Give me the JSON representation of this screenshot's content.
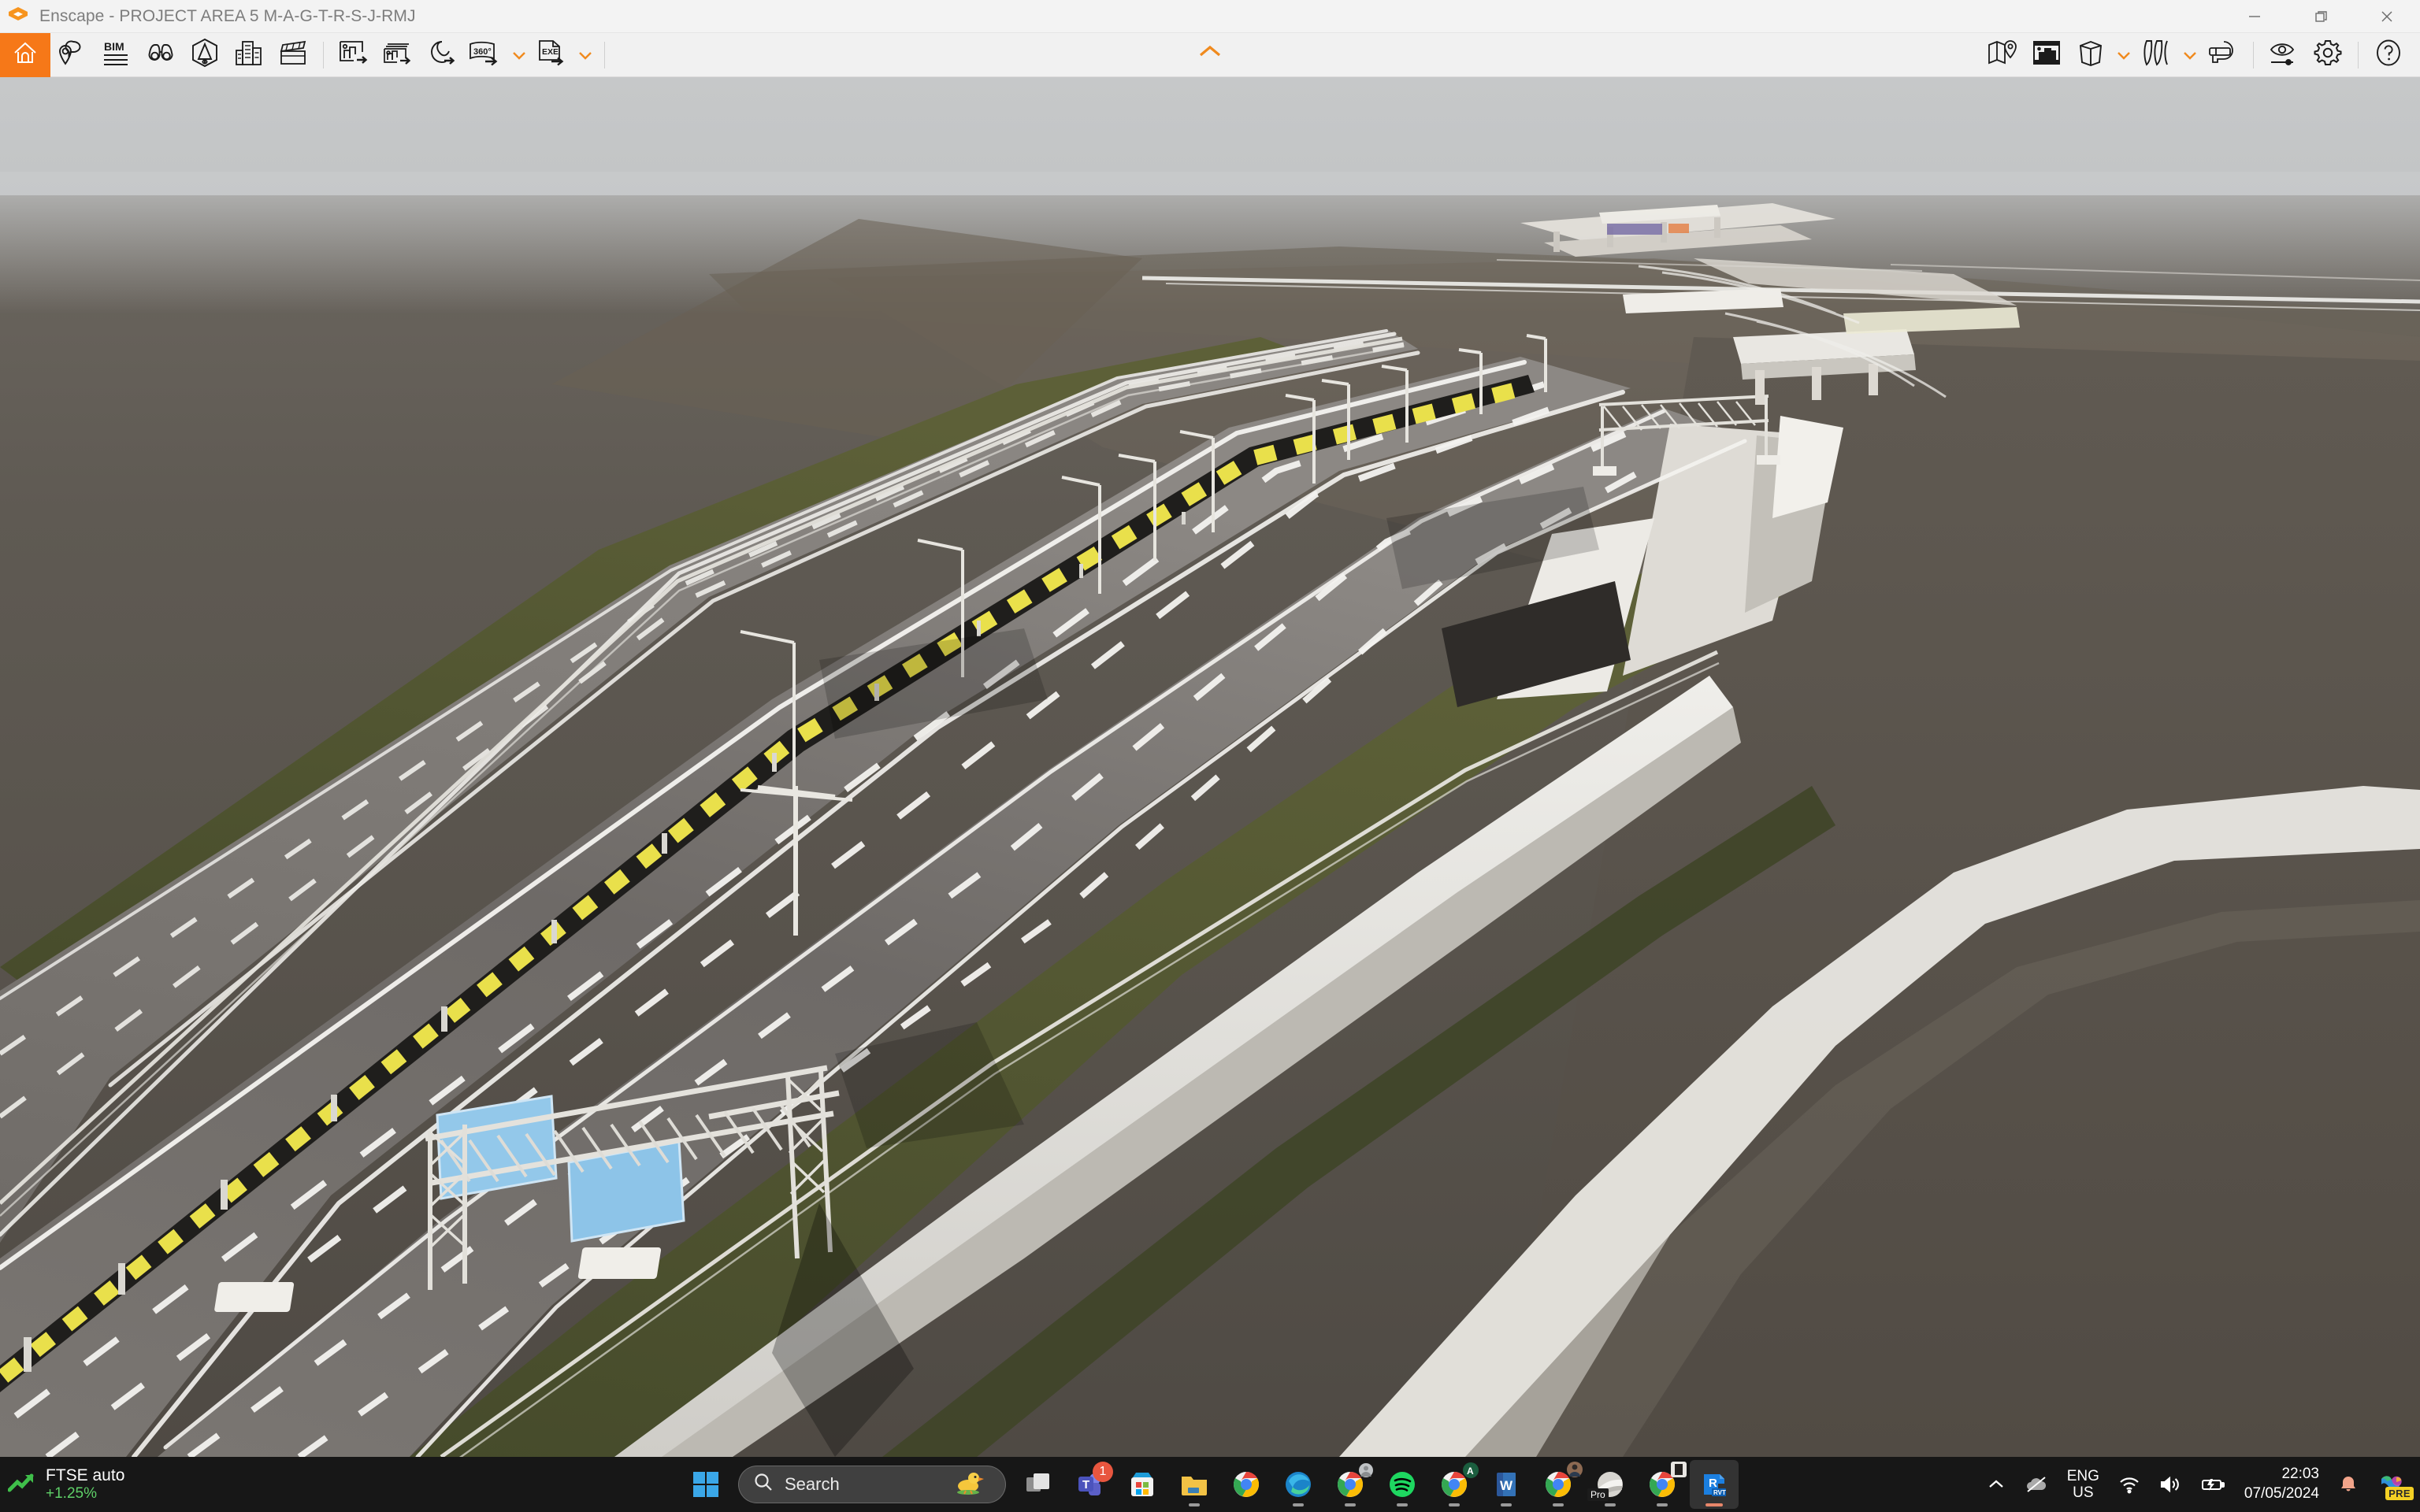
{
  "window": {
    "app_name": "Enscape",
    "title": "Enscape - PROJECT AREA 5 M-A-G-T-R-S-J-RMJ",
    "controls": {
      "minimize": "Minimize",
      "restore": "Restore",
      "close": "Close"
    },
    "accent_color": "#f67818",
    "titlebar_bg": "#f3f3f3",
    "toolbar_bg": "#f1f1f1"
  },
  "toolbar": {
    "left_items": [
      {
        "name": "home",
        "label": "Home",
        "icon": "home-icon"
      },
      {
        "name": "views",
        "label": "Views",
        "icon": "pin-chat-icon"
      },
      {
        "name": "bim",
        "label": "BIM Info",
        "icon": "bim-icon"
      },
      {
        "name": "visual_presets",
        "label": "Visual Settings Presets",
        "icon": "binoculars-icon"
      },
      {
        "name": "asset_library",
        "label": "Asset Library",
        "icon": "asset-box-icon"
      },
      {
        "name": "material_library",
        "label": "Material Library",
        "icon": "buildings-icon"
      },
      {
        "name": "video_editor",
        "label": "Video Editor",
        "icon": "clapperboard-icon"
      },
      {
        "name": "render_image",
        "label": "Render Image",
        "icon": "render-image-icon"
      },
      {
        "name": "batch_render",
        "label": "Batch Rendering",
        "icon": "batch-render-icon"
      },
      {
        "name": "panorama",
        "label": "Render Panorama",
        "icon": "panorama-icon"
      },
      {
        "name": "export_360",
        "label": "360",
        "icon": "export-360-icon",
        "has_dropdown": true
      },
      {
        "name": "export_exe",
        "label": "EXE",
        "icon": "export-exe-icon",
        "has_dropdown": true
      }
    ],
    "right_items": [
      {
        "name": "site_context",
        "label": "Site Context",
        "icon": "map-pin-icon"
      },
      {
        "name": "project_view",
        "label": "Project",
        "icon": "project-frame-icon"
      },
      {
        "name": "view_mode",
        "label": "View Mode",
        "icon": "cube-icon",
        "has_dropdown": true
      },
      {
        "name": "atmosphere",
        "label": "Atmosphere",
        "icon": "curtains-icon",
        "has_dropdown": true
      },
      {
        "name": "vr_mode",
        "label": "Virtual Reality",
        "icon": "vr-headset-icon"
      },
      {
        "name": "visual_settings",
        "label": "Visual Settings",
        "icon": "eye-slider-icon"
      },
      {
        "name": "settings",
        "label": "Settings",
        "icon": "gear-icon"
      },
      {
        "name": "help",
        "label": "Help",
        "icon": "question-icon"
      }
    ],
    "collapse_label": "Collapse toolbar",
    "caret_color": "#f08a1e"
  },
  "viewport": {
    "name": "enscape-3d-render-viewport",
    "description": "Real-time rendered aerial view of a multi-lane expressway interchange with gantry signage, median barriers and embankments",
    "scene": {
      "sky_top": "#c6c8c9",
      "sky_bottom": "#8d8a85",
      "ground": "#5b5650",
      "asphalt": "#6e6a67",
      "grass": "#4e5331",
      "barrier_yellow": "#e8e04a",
      "barrier_dark": "#2a2a28",
      "sign_blue": "#8ec5e8",
      "concrete": "#e9e8e4",
      "lane_marking": "#f2f2ef"
    }
  },
  "taskbar": {
    "widget": {
      "title": "FTSE auto",
      "change": "+1.25%",
      "change_color": "#5fd068",
      "icon": "trend-up-icon"
    },
    "start": {
      "label": "Start",
      "icon": "windows-logo-icon"
    },
    "search": {
      "placeholder": "Search",
      "icon": "search-icon",
      "mascot": "duck-icon"
    },
    "apps": [
      {
        "name": "task-view",
        "label": "Task View",
        "running": false
      },
      {
        "name": "microsoft-teams",
        "label": "Microsoft Teams",
        "badge": "1",
        "running": false
      },
      {
        "name": "microsoft-store",
        "label": "Microsoft Store",
        "running": false
      },
      {
        "name": "file-explorer",
        "label": "File Explorer",
        "running": true
      },
      {
        "name": "google-chrome",
        "label": "Google Chrome",
        "running": false
      },
      {
        "name": "microsoft-edge",
        "label": "Microsoft Edge",
        "running": true
      },
      {
        "name": "google-chrome-profile",
        "label": "Google Chrome",
        "running": true
      },
      {
        "name": "spotify",
        "label": "Spotify",
        "running": true
      },
      {
        "name": "google-chrome-account-a",
        "label": "Google Chrome",
        "running": true
      },
      {
        "name": "microsoft-word",
        "label": "Microsoft Word",
        "running": true
      },
      {
        "name": "google-chrome-account-b",
        "label": "Google Chrome",
        "running": true
      },
      {
        "name": "lumion-pro",
        "label": "Lumion Pro",
        "running": true
      },
      {
        "name": "google-chrome-account-c",
        "label": "Google Chrome",
        "running": true
      },
      {
        "name": "autodesk-revit",
        "label": "Autodesk Revit RVT",
        "running": true,
        "active": true
      }
    ],
    "tray": {
      "overflow": "Show hidden icons",
      "onedrive": "OneDrive - not signed in",
      "language": {
        "line1": "ENG",
        "line2": "US"
      },
      "wifi": "Network",
      "volume": "Volume",
      "battery": "Battery charging",
      "time": "22:03",
      "date": "07/05/2024",
      "notifications": "Notifications",
      "copilot": {
        "label": "Copilot",
        "badge": "PRE"
      }
    }
  }
}
